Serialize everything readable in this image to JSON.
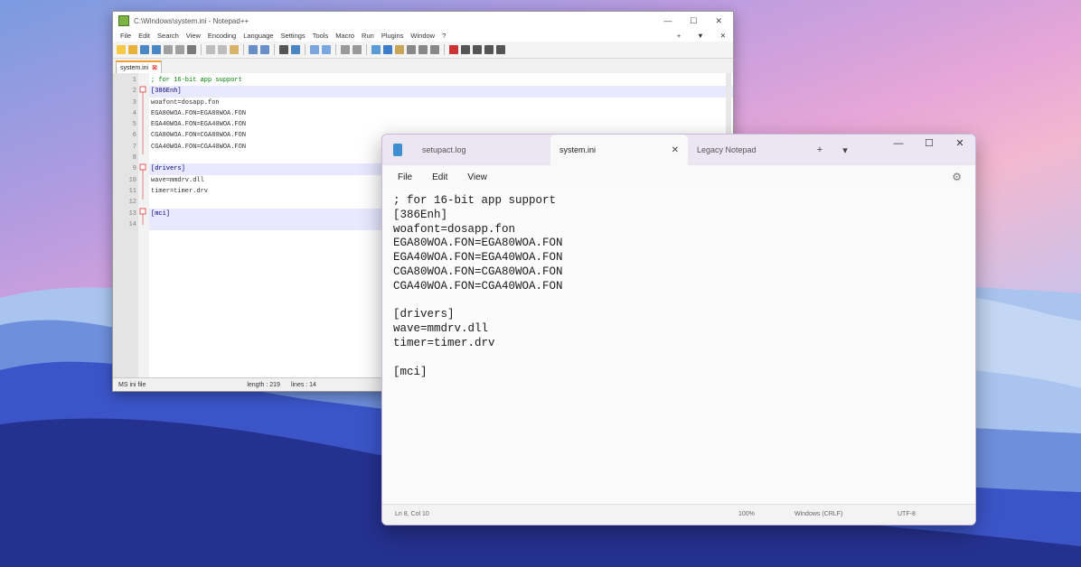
{
  "wallpaper": {
    "colors": {
      "sky_top": "#7a9be0",
      "pink": "#f2b8d0",
      "mountain_dark": "#25318f",
      "mountain_mid": "#3b55c8",
      "mountain_light": "#a9c4ef"
    }
  },
  "npp": {
    "title": "C:\\Windows\\system.ini - Notepad++",
    "controls": {
      "minimize": "—",
      "maximize": "☐",
      "close": "✕"
    },
    "menu": [
      "File",
      "Edit",
      "Search",
      "View",
      "Encoding",
      "Language",
      "Settings",
      "Tools",
      "Macro",
      "Run",
      "Plugins",
      "Window",
      "?"
    ],
    "menu_right": {
      "add": "+",
      "down": "▼",
      "close": "✕"
    },
    "tab": {
      "label": "system.ini",
      "close": "⊠"
    },
    "line_numbers": [
      "1",
      "2",
      "3",
      "4",
      "5",
      "6",
      "7",
      "8",
      "9",
      "10",
      "11",
      "12",
      "13",
      "14"
    ],
    "lines": [
      "; for 16-bit app support",
      "[386Enh]",
      "woafont=dosapp.fon",
      "EGA80WOA.FON=EGA80WOA.FON",
      "EGA40WOA.FON=EGA40WOA.FON",
      "CGA80WOA.FON=CGA80WOA.FON",
      "CGA40WOA.FON=CGA40WOA.FON",
      "",
      "[drivers]",
      "wave=mmdrv.dll",
      "timer=timer.drv",
      "",
      "[mci]",
      ""
    ],
    "status": {
      "file_type": "MS ini file",
      "length": "length : 219",
      "lines": "lines : 14"
    }
  },
  "notepad": {
    "tabs": [
      {
        "label": "setupact.log",
        "close": ""
      },
      {
        "label": "system.ini",
        "close": "✕"
      },
      {
        "label": "Legacy Notepad",
        "close": ""
      }
    ],
    "tab_plus": "+",
    "tab_dropdown": "▾",
    "controls": {
      "minimize": "—",
      "maximize": "☐",
      "close": "✕"
    },
    "menu": [
      "File",
      "Edit",
      "View"
    ],
    "settings_icon": "⚙",
    "lines": [
      "; for 16-bit app support",
      "[386Enh]",
      "woafont=dosapp.fon",
      "EGA80WOA.FON=EGA80WOA.FON",
      "EGA40WOA.FON=EGA40WOA.FON",
      "CGA80WOA.FON=CGA80WOA.FON",
      "CGA40WOA.FON=CGA40WOA.FON",
      "",
      "[drivers]",
      "wave=mmdrv.dll",
      "timer=timer.drv",
      "",
      "[mci]"
    ],
    "status": {
      "position": "Ln 8, Col 10",
      "zoom": "100%",
      "line_ending": "Windows (CRLF)",
      "encoding": "UTF-8"
    }
  }
}
